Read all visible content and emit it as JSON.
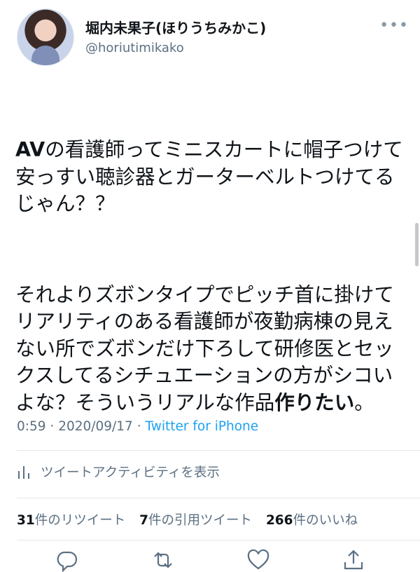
{
  "tweet": {
    "display_name": "堀内未果子(ほりうちみかこ)",
    "handle": "@horiutimikako",
    "more": "•••",
    "paragraph1_bold": "AV",
    "paragraph1_rest": "の看護師ってミニスカートに帽子つけて安っすい聴診器とガーターベルトつけてるじゃん？？",
    "paragraph2_plain": "それよりズボンタイプでピッチ首に掛けてリアリティのある看護師が夜勤病棟の見えない所でズボンだけ下ろして研修医とセックスしてるシチュエーションの方がシコいよな？そういうリアルな作品",
    "paragraph2_bold": "作りたい",
    "paragraph2_end": "。",
    "time": "0:59",
    "date": "2020/09/17",
    "separator": " · ",
    "source": "Twitter for iPhone"
  },
  "activity": {
    "label": "ツイートアクティビティを表示"
  },
  "stats": {
    "retweets_count": "31",
    "retweets_label": "件のリツイート",
    "quotes_count": "7",
    "quotes_label": "件の引用ツイート",
    "likes_count": "266",
    "likes_label": "件のいいね"
  },
  "icons": [
    "bar-chart-icon",
    "reply-icon",
    "retweet-icon",
    "like-icon",
    "share-icon"
  ],
  "colors": {
    "link": "#1da1f2",
    "secondary": "#5b7083",
    "text": "#0f1419",
    "divider": "#e1e8ed"
  }
}
